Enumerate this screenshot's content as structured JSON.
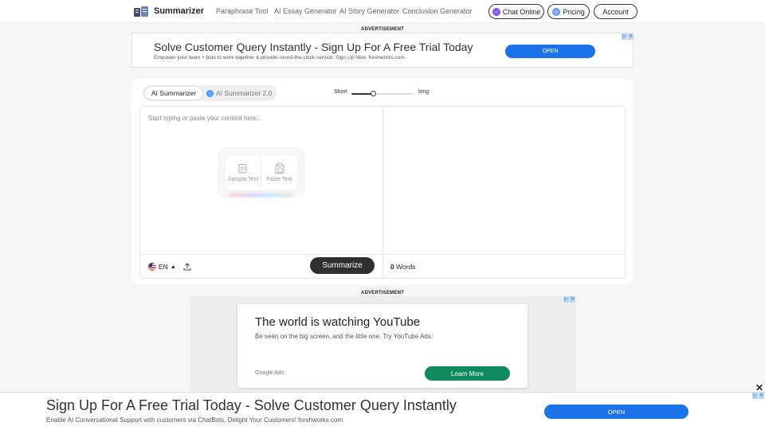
{
  "header": {
    "brand": "Summarizer",
    "nav": [
      "Paraphrase Tool",
      "AI Essay Generator",
      "AI Story Generator",
      "Conclusion Generator"
    ],
    "chat_label": "Chat Online",
    "pricing_label": "Pricing",
    "account_label": "Account"
  },
  "ads": {
    "label": "ADVERTISEMENT",
    "top": {
      "headline": "Solve Customer Query Instantly - Sign Up For A Free Trial Today",
      "subtext": "Empower your team + bots to work together & provide round-the-clock service. Sign Up Now. freshworks.com",
      "button": "OPEN"
    },
    "middle": {
      "headline": "The world is watching YouTube",
      "subtext": "Be seen on the big screen, and the little one. Try YouTube Ads.",
      "provider": "Google Ads",
      "button": "Learn More"
    },
    "bottom": {
      "headline": "Sign Up For A Free Trial Today - Solve Customer Query Instantly",
      "subtext": "Enable AI Conversational Support with customers via ChatBots, Delight Your Customers! freshworks.com",
      "button": "OPEN",
      "close": "✕"
    }
  },
  "tool": {
    "tabs": [
      "AI Summarizer",
      "AI Summarizer 2.0"
    ],
    "slider": {
      "min_label": "Short",
      "max_label": "long",
      "value": 0.35
    },
    "placeholder": "Start typing or paste your content here...",
    "sample_text": "Sample Text",
    "paste_text": "Paste Text",
    "language": "EN",
    "summarize_label": "Summarize",
    "word_count": "0",
    "words_label": "Words"
  },
  "colors": {
    "primary_dark": "#2f2f2f",
    "ad_blue": "#1a73e8",
    "ad_green": "#0f8a5f"
  }
}
